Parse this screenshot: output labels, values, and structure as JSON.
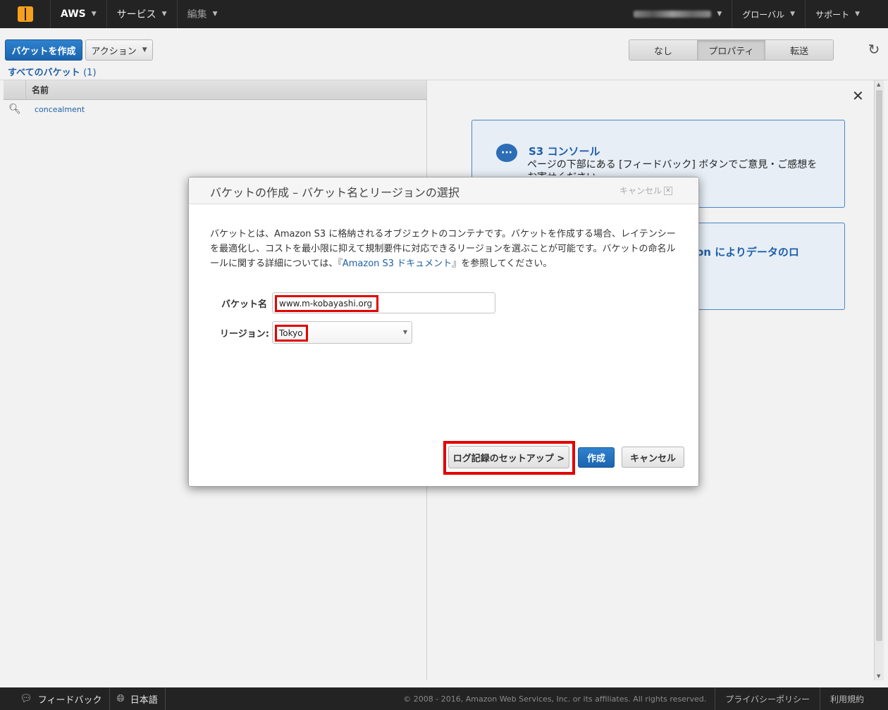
{
  "topnav": {
    "brand": "AWS",
    "services": "サービス",
    "edit": "編集",
    "region": "グローバル",
    "support": "サポート"
  },
  "toolbar": {
    "create_bucket": "バケットを作成",
    "actions": "アクション",
    "view_tabs": [
      "なし",
      "プロパティ",
      "転送"
    ],
    "active_tab": "プロパティ",
    "all_buckets": "すべてのバケット",
    "bucket_count": "(1)"
  },
  "table": {
    "column_name": "名前",
    "rows": [
      "concealment"
    ]
  },
  "info_cards": {
    "card1_title": "S3 コンソール",
    "card1_text": "ページの下部にある [フィードバック] ボタンでご意見・ご感想をお寄せください。",
    "card2_title": "on によりデータのロ"
  },
  "modal": {
    "title": "バケットの作成 – バケット名とリージョンの選択",
    "cancel_top": "キャンセル",
    "desc_part1": "バケットとは、Amazon S3 に格納されるオブジェクトのコンテナです。バケットを作成する場合、レイテンシーを最適化し、コストを最小限に抑えて規制要件に対応できるリージョンを選ぶことが可能です。バケットの命名ルールに関する詳細については、『",
    "desc_link": "Amazon S3 ドキュメント",
    "desc_part2": "』を参照してください。",
    "bucket_label": "バケット名",
    "bucket_value": "www.m-kobayashi.org",
    "region_label": "リージョン:",
    "region_value": "Tokyo",
    "btn_logging": "ログ記録のセットアップ >",
    "btn_create": "作成",
    "btn_cancel": "キャンセル"
  },
  "footer": {
    "feedback": "フィードバック",
    "language": "日本語",
    "copyright": "© 2008 - 2016, Amazon Web Services, Inc. or its affiliates. All rights reserved.",
    "privacy": "プライバシーポリシー",
    "terms": "利用規約"
  },
  "colors": {
    "primary": "#1b64ad",
    "highlight": "#e30000",
    "topbar": "#232323"
  }
}
